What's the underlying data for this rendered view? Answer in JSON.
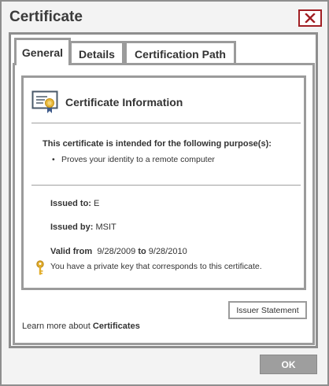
{
  "window": {
    "title": "Certificate",
    "close_icon": "close-x-icon",
    "accent_color": "#a11f24"
  },
  "tabs": [
    {
      "label": "General",
      "active": true
    },
    {
      "label": "Details",
      "active": false
    },
    {
      "label": "Certification Path",
      "active": false
    }
  ],
  "info": {
    "icon": "certificate-icon",
    "title": "Certificate Information",
    "purpose_heading": "This certificate is intended for the following purpose(s):",
    "purposes": [
      "Proves your identity to a remote computer"
    ],
    "issued_to_label": "Issued to:",
    "issued_to_value": "E",
    "issued_by_label": "Issued by:",
    "issued_by_value": "MSIT",
    "valid_from_label": "Valid from",
    "valid_from_value": "9/28/2009",
    "valid_to_label": "to",
    "valid_to_value": "9/28/2010",
    "key_icon": "key-icon",
    "key_note": "You have a private key that corresponds to this certificate."
  },
  "buttons": {
    "issuer_statement": "Issuer Statement",
    "ok": "OK"
  },
  "learn_more": {
    "prefix": "Learn more about",
    "link": "Certificates"
  }
}
